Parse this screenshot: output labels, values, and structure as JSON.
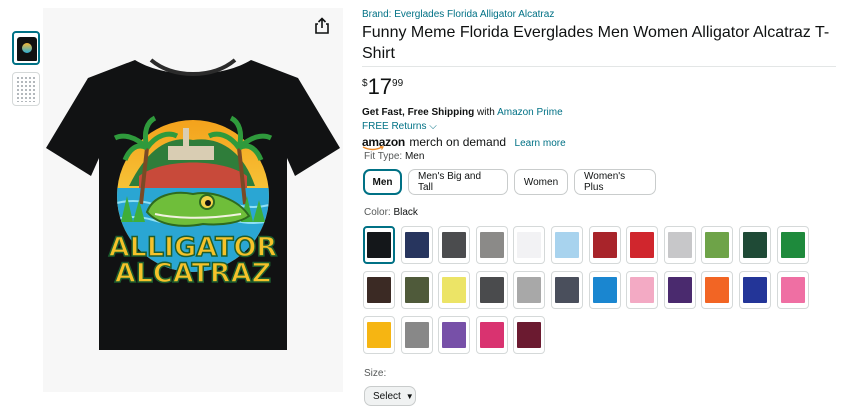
{
  "product": {
    "brand": "Brand: Everglades Florida Alligator Alcatraz",
    "title": "Funny Meme Florida Everglades Men Women Alligator Alcatraz T-Shirt",
    "price": {
      "symbol": "$",
      "whole": "17",
      "fraction": "99"
    }
  },
  "image": {
    "shirt_text_line1": "ALLIGATOR",
    "shirt_text_line2": "ALCATRAZ",
    "share_icon": "share-icon"
  },
  "shipping": {
    "prefix": "Get Fast, Free Shipping",
    "with": "with",
    "prime": "Amazon Prime",
    "returns": "FREE Returns",
    "merch_amazon": "amazon",
    "merch_brand": "merch on demand",
    "learn_more": "Learn more"
  },
  "fit": {
    "label": "Fit Type:",
    "value": "Men",
    "options": [
      "Men",
      "Men's Big and Tall",
      "Women",
      "Women's Plus"
    ],
    "selected": 0
  },
  "color": {
    "label": "Color:",
    "value": "Black",
    "swatches": [
      "#14171a",
      "#27355e",
      "#4b4c4e",
      "#8b8a88",
      "#f2f2f4",
      "#a8d3ee",
      "#a8242a",
      "#d0262d",
      "#c7c7c9",
      "#6ea348",
      "#1f4a36",
      "#1e8a3c",
      "#3b2a24",
      "#4f5a3a",
      "#ece466",
      "#4a4b4d",
      "#a8a8a8",
      "#4a4f5c",
      "#1a86d0",
      "#f3aac4",
      "#4a2a6e",
      "#f26524",
      "#233598",
      "#ef6fa3",
      "#f6b512",
      "#888888",
      "#7750a8",
      "#d93370",
      "#6b1a30"
    ],
    "selected": 0
  },
  "size": {
    "label": "Size:",
    "select_value": "Select"
  }
}
